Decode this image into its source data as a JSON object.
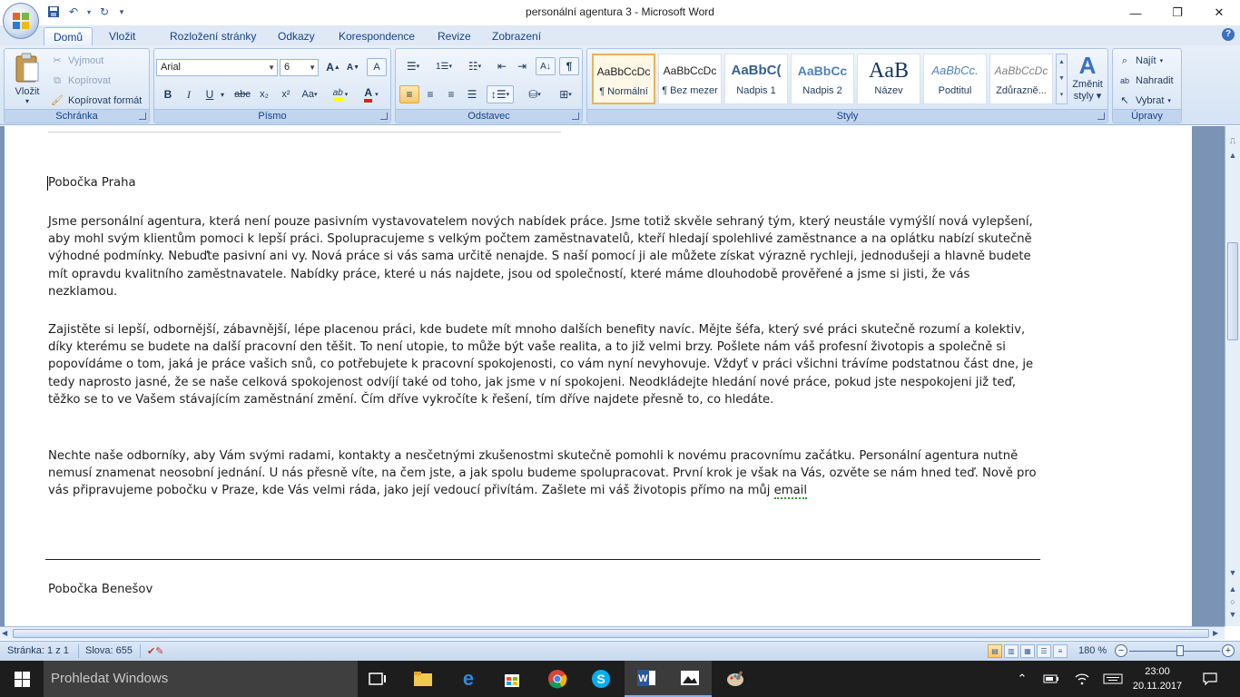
{
  "window": {
    "title": "personální agentura 3 - Microsoft Word",
    "controls": {
      "minimize": "—",
      "restore": "❐",
      "close": "✕"
    }
  },
  "tabs": [
    "Domů",
    "Vložit",
    "Rozložení stránky",
    "Odkazy",
    "Korespondence",
    "Revize",
    "Zobrazení"
  ],
  "active_tab": "Domů",
  "ribbon": {
    "clipboard": {
      "label": "Schránka",
      "paste": "Vložit",
      "cut": "Vyjmout",
      "copy": "Kopírovat",
      "format_painter": "Kopírovat formát"
    },
    "font": {
      "label": "Písmo",
      "font_name": "Arial",
      "font_size": "6",
      "bold": "B",
      "italic": "I",
      "underline": "U",
      "strike": "abc",
      "subscript": "x₂",
      "superscript": "x²",
      "change_case": "Aa",
      "grow": "A",
      "shrink": "A",
      "clear": "A",
      "highlight": "ab",
      "font_color": "A"
    },
    "paragraph": {
      "label": "Odstavec",
      "pilcrow": "¶"
    },
    "styles": {
      "label": "Styly",
      "items": [
        {
          "preview": "AaBbCcDc",
          "name": "¶ Normální"
        },
        {
          "preview": "AaBbCcDc",
          "name": "¶ Bez mezer"
        },
        {
          "preview": "AaBbC(",
          "name": "Nadpis 1"
        },
        {
          "preview": "AaBbCc",
          "name": "Nadpis 2"
        },
        {
          "preview": "AaB",
          "name": "Název"
        },
        {
          "preview": "AaBbCc.",
          "name": "Podtitul"
        },
        {
          "preview": "AaBbCcDc",
          "name": "Zdůrazně..."
        }
      ],
      "change_styles_line1": "Změnit",
      "change_styles_line2": "styly"
    },
    "editing": {
      "label": "Úpravy",
      "find": "Najít",
      "replace": "Nahradit",
      "select": "Vybrat"
    }
  },
  "document": {
    "heading1": "Pobočka Praha",
    "para1": "Jsme personální agentura, která není pouze pasivním vystavovatelem nových nabídek práce. Jsme totiž skvěle sehraný tým, který neustále vymýšlí nová vylepšení, aby mohl svým klientům pomoci k lepší práci. Spolupracujeme s velkým počtem zaměstnavatelů, kteří hledají spolehlivé zaměstnance a na oplátku nabízí skutečně výhodné podmínky. Nebuďte pasivní ani vy. Nová práce si vás sama určitě nenajde. S naší pomocí ji ale můžete získat výrazně rychleji, jednodušeji a hlavně budete mít opravdu kvalitního zaměstnavatele. Nabídky práce, které u nás najdete, jsou od společností, které máme dlouhodobě prověřené a jsme si jisti, že vás nezklamou.",
    "para2": "Zajistěte si lepší, odbornější, zábavnější, lépe placenou práci, kde budete mít mnoho dalších benefity navíc. Mějte šéfa, který své práci skutečně rozumí a kolektiv, díky kterému se budete na další pracovní den těšit. To není utopie, to může být vaše realita, a to již velmi brzy. Pošlete nám váš profesní životopis a společně si popovídáme o tom, jaká je práce vašich snů, co potřebujete k pracovní spokojenosti, co vám nyní nevyhovuje. Vždyť v práci všichni trávíme podstatnou část dne, je tedy naprosto jasné, že se naše celková spokojenost odvíjí také od toho, jak jsme v ní spokojeni. Neodkládejte hledání nové práce, pokud jste nespokojeni již teď, těžko se to ve Vašem stávajícím zaměstnání změní. Čím dříve vykročíte k řešení, tím dříve najdete přesně to, co hledáte.",
    "para3_text": "Nechte naše odborníky, aby Vám svými radami, kontakty a nesčetnými zkušenostmi skutečně pomohli k novému pracovnímu začátku. Personální agentura nutně nemusí znamenat neosobní jednání. U nás přesně víte, na čem jste, a jak spolu budeme spolupracovat. První krok je však na Vás, ozvěte se nám hned teď. Nově pro vás připravujeme pobočku v Praze, kde Vás velmi ráda, jako její vedoucí přivítám. Zašlete mi váš životopis přímo na můj ",
    "para3_flagged": "email",
    "heading2": "Pobočka Benešov"
  },
  "statusbar": {
    "page": "Stránka: 1 z 1",
    "words": "Slova: 655",
    "zoom": "180 %",
    "zoom_minus": "−",
    "zoom_plus": "+"
  },
  "taskbar": {
    "search_placeholder": "Prohledat Windows",
    "apps": [
      "task-view-icon",
      "file-explorer-icon",
      "edge-icon",
      "store-icon",
      "chrome-icon",
      "skype-icon",
      "word-icon",
      "photos-icon",
      "paint-icon"
    ],
    "time": "23:00",
    "date": "20.11.2017"
  },
  "colors": {
    "ribbon_blue": "#15428b",
    "taskbar": "#1d1d1d",
    "doc_background": "#7b93b5",
    "active_style_border": "#e9b35a"
  }
}
